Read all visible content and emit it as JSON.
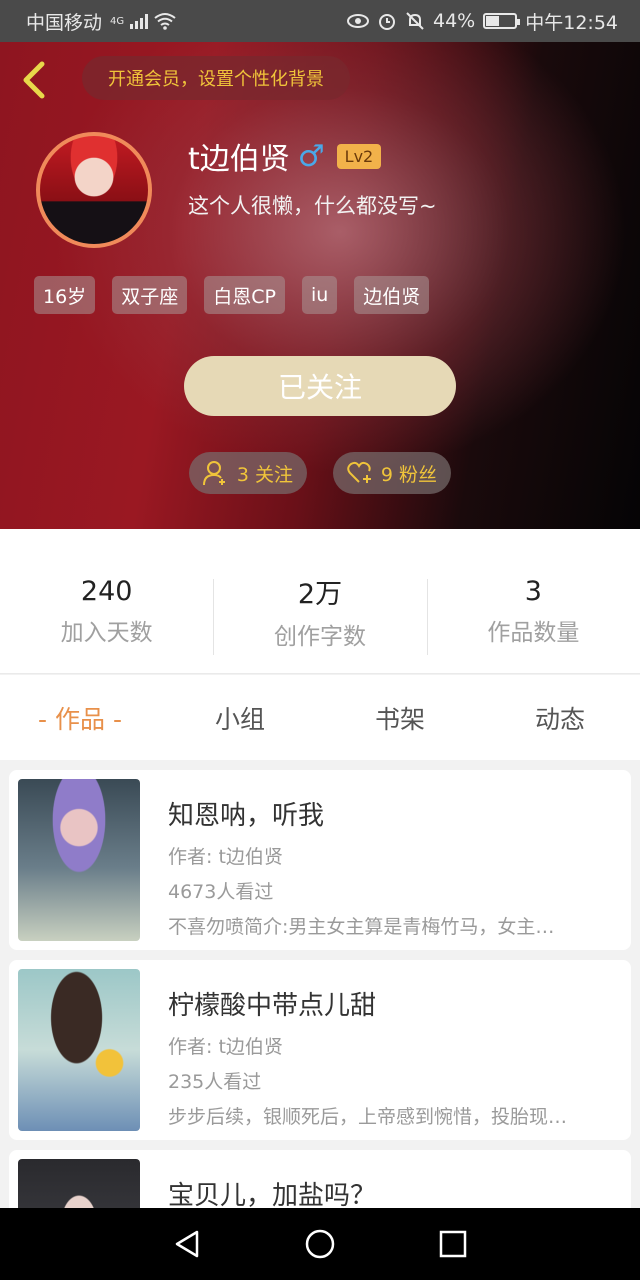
{
  "status_bar": {
    "carrier": "中国移动",
    "network": "4G",
    "battery": "44%",
    "time": "中午12:54"
  },
  "header": {
    "vip_banner": "开通会员，设置个性化背景",
    "username": "t边伯贤",
    "gender_icon": "male-icon",
    "level": "Lv2",
    "bio": "这个人很懒，什么都没写~",
    "tags": [
      "16岁",
      "双子座",
      "白恩CP",
      "iu",
      "边伯贤"
    ],
    "follow_button": "已关注",
    "following": "3 关注",
    "fans": "9 粉丝"
  },
  "stats": [
    {
      "value": "240",
      "label": "加入天数"
    },
    {
      "value": "2万",
      "label": "创作字数"
    },
    {
      "value": "3",
      "label": "作品数量"
    }
  ],
  "tabs": [
    "- 作品 -",
    "小组",
    "书架",
    "动态"
  ],
  "works": [
    {
      "title": "知恩呐，听我",
      "author": "作者: t边伯贤",
      "views": "4673人看过",
      "desc": "不喜勿喷简介:男主女主算是青梅竹马，女主…"
    },
    {
      "title": "柠檬酸中带点儿甜",
      "author": "作者: t边伯贤",
      "views": "235人看过",
      "desc": "步步后续，银顺死后，上帝感到惋惜，投胎现…"
    },
    {
      "title": "宝贝儿，加盐吗？",
      "author": "",
      "views": "",
      "desc": ""
    }
  ],
  "colors": {
    "accent": "#e8904a",
    "gold": "#f0c43a",
    "follow_button": "#e6d9b6"
  }
}
